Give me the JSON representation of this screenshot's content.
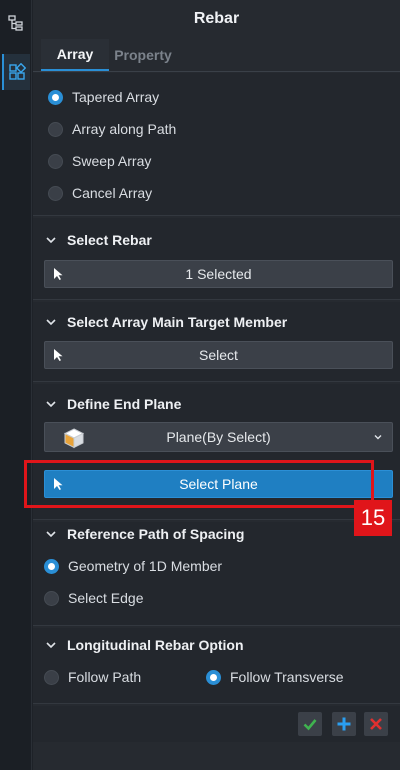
{
  "panel": {
    "title": "Rebar"
  },
  "tabs": [
    {
      "label": "Array",
      "active": true
    },
    {
      "label": "Property",
      "active": false
    }
  ],
  "array_type": {
    "options": [
      "Tapered Array",
      "Array along Path",
      "Sweep Array",
      "Cancel Array"
    ],
    "selected": "Tapered Array"
  },
  "select_rebar": {
    "header": "Select Rebar",
    "button": "1 Selected"
  },
  "select_target": {
    "header": "Select Array Main Target Member",
    "button": "Select"
  },
  "end_plane": {
    "header": "Define End Plane",
    "dropdown_value": "Plane(By Select)",
    "button": "Select Plane"
  },
  "annotation": {
    "number": "15"
  },
  "spacing_path": {
    "header": "Reference Path of Spacing",
    "options": [
      "Geometry of 1D Member",
      "Select Edge"
    ],
    "selected": "Geometry of 1D Member"
  },
  "longitudinal": {
    "header": "Longitudinal Rebar Option",
    "options": [
      "Follow Path",
      "Follow Transverse"
    ],
    "selected": "Follow Transverse"
  },
  "colors": {
    "accent": "#2a8fd6",
    "callout": "#e0151a",
    "ok": "#3fb34f",
    "cancel": "#e0302f"
  },
  "icons": [
    "tree-icon",
    "rebar-icon",
    "chevron-down-icon",
    "cursor-icon",
    "plane-cube-icon",
    "check-icon",
    "plus-icon",
    "close-icon"
  ]
}
